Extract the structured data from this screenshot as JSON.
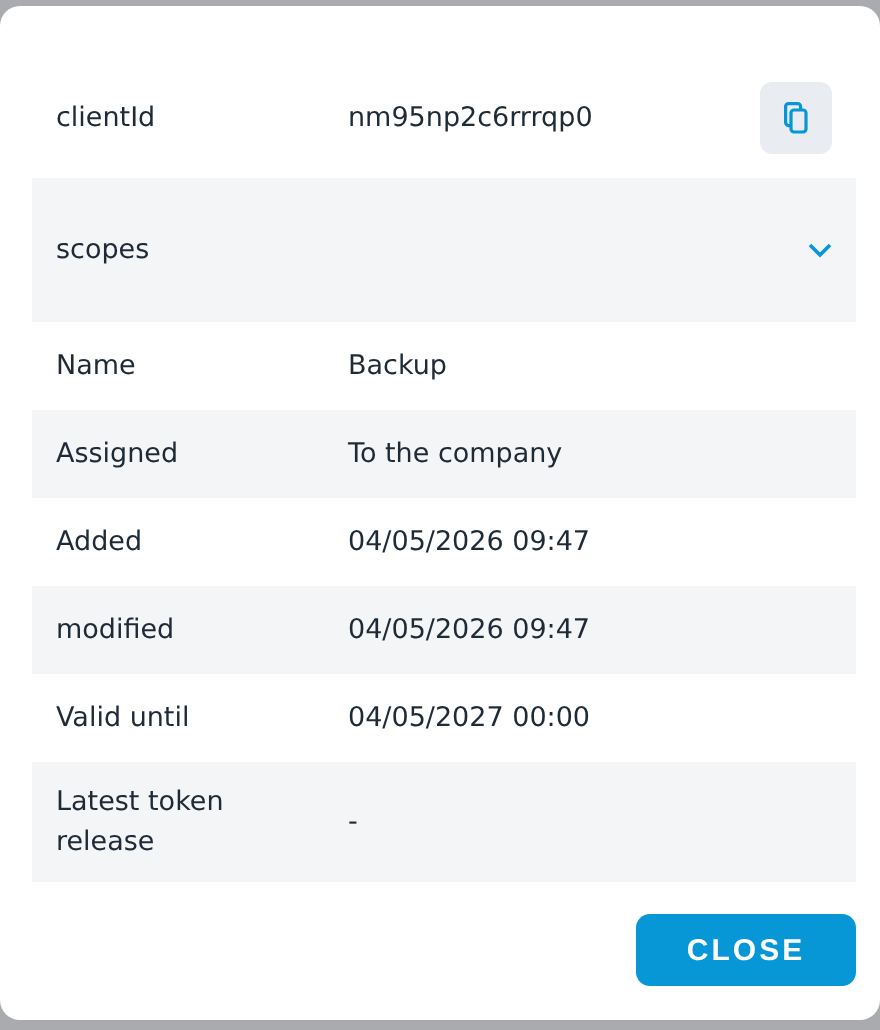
{
  "client_id": {
    "label": "clientId",
    "value": "nm95np2c6rrrqp0"
  },
  "scopes": {
    "label": "scopes",
    "expanded": false
  },
  "details": [
    {
      "label": "Name",
      "value": "Backup"
    },
    {
      "label": "Assigned",
      "value": "To the company"
    },
    {
      "label": "Added",
      "value": "04/05/2026 09:47"
    },
    {
      "label": "modified",
      "value": "04/05/2026 09:47"
    },
    {
      "label": "Valid until",
      "value": "04/05/2027 00:00"
    },
    {
      "label": "Latest token release",
      "value": "-"
    }
  ],
  "buttons": [
    "CLOSE"
  ]
}
